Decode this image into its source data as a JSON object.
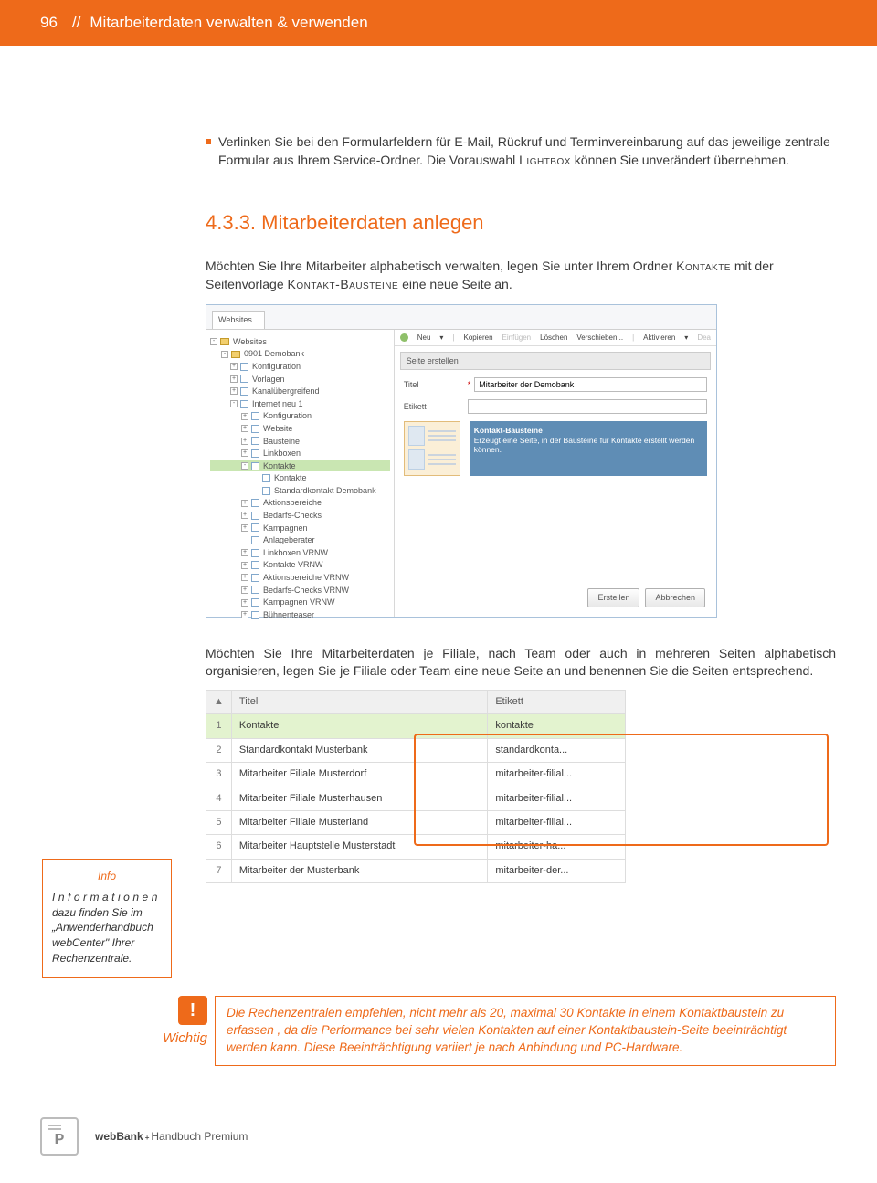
{
  "header": {
    "page_number": "96",
    "separator": "//",
    "title": "Mitarbeiterdaten verwalten & verwenden"
  },
  "bullet": {
    "text_a": "Verlinken Sie bei den Formularfeldern für E-Mail, Rückruf und Terminvereinbarung auf das jeweilige zentrale Formular aus Ihrem Service-Ordner. Die Vorauswahl ",
    "sc": "Lightbox",
    "text_b": " können Sie unverändert übernehmen."
  },
  "section": {
    "num": "4.3.3. ",
    "title": "Mitarbeiterdaten anlegen"
  },
  "intro": {
    "a": "Möchten Sie Ihre Mitarbeiter alphabetisch verwalten, legen Sie unter Ihrem Ordner ",
    "sc1": "Kontakte",
    "b": " mit der Seitenvorlage ",
    "sc2": "Kontakt-Bausteine",
    "c": " eine neue Seite an."
  },
  "ss": {
    "tab": "Websites",
    "toolbar": {
      "neu": "Neu",
      "kopieren": "Kopieren",
      "einfuegen": "Einfügen",
      "loeschen": "Löschen",
      "verschieben": "Verschieben...",
      "aktivieren": "Aktivieren",
      "dea": "Dea"
    },
    "create_hdr": "Seite erstellen",
    "form": {
      "titel_lbl": "Titel",
      "titel_val": "Mitarbeiter der Demobank",
      "etikett_lbl": "Etikett",
      "star": "*"
    },
    "desc": {
      "title": "Kontakt-Bausteine",
      "body": "Erzeugt eine Seite, in der Bausteine für Kontakte erstellt werden können."
    },
    "btn": {
      "erstellen": "Erstellen",
      "abbrechen": "Abbrechen"
    },
    "tree": [
      {
        "lvl": 0,
        "t": "fld",
        "txt": "Websites",
        "pm": "-"
      },
      {
        "lvl": 1,
        "t": "fld",
        "txt": "0901 Demobank",
        "pm": "-"
      },
      {
        "lvl": 2,
        "t": "pg",
        "txt": "Konfiguration",
        "pm": "+"
      },
      {
        "lvl": 2,
        "t": "pg",
        "txt": "Vorlagen",
        "pm": "+"
      },
      {
        "lvl": 2,
        "t": "pg",
        "txt": "Kanalübergreifend",
        "pm": "+"
      },
      {
        "lvl": 2,
        "t": "pg",
        "txt": "Internet neu 1",
        "pm": "-"
      },
      {
        "lvl": 3,
        "t": "pg",
        "txt": "Konfiguration",
        "pm": "+"
      },
      {
        "lvl": 3,
        "t": "pg",
        "txt": "Website",
        "pm": "+"
      },
      {
        "lvl": 3,
        "t": "pg",
        "txt": "Bausteine",
        "pm": "+"
      },
      {
        "lvl": 3,
        "t": "pg",
        "txt": "Linkboxen",
        "pm": "+"
      },
      {
        "lvl": 3,
        "t": "pg",
        "txt": "Kontakte",
        "pm": "-",
        "hl": true
      },
      {
        "lvl": 4,
        "t": "pg",
        "txt": "Kontakte",
        "pm": ""
      },
      {
        "lvl": 4,
        "t": "pg",
        "txt": "Standardkontakt Demobank",
        "pm": ""
      },
      {
        "lvl": 3,
        "t": "pg",
        "txt": "Aktionsbereiche",
        "pm": "+"
      },
      {
        "lvl": 3,
        "t": "pg",
        "txt": "Bedarfs-Checks",
        "pm": "+"
      },
      {
        "lvl": 3,
        "t": "pg",
        "txt": "Kampagnen",
        "pm": "+"
      },
      {
        "lvl": 3,
        "t": "pg",
        "txt": "Anlageberater",
        "pm": ""
      },
      {
        "lvl": 3,
        "t": "pg",
        "txt": "Linkboxen VRNW",
        "pm": "+"
      },
      {
        "lvl": 3,
        "t": "pg",
        "txt": "Kontakte VRNW",
        "pm": "+"
      },
      {
        "lvl": 3,
        "t": "pg",
        "txt": "Aktionsbereiche VRNW",
        "pm": "+"
      },
      {
        "lvl": 3,
        "t": "pg",
        "txt": "Bedarfs-Checks VRNW",
        "pm": "+"
      },
      {
        "lvl": 3,
        "t": "pg",
        "txt": "Kampagnen VRNW",
        "pm": "+"
      },
      {
        "lvl": 3,
        "t": "pg",
        "txt": "Bühnenteaser",
        "pm": "+"
      }
    ]
  },
  "mid_para": "Möchten Sie Ihre Mitarbeiterdaten je Filiale, nach Team oder auch in mehreren Seiten alphabetisch organisieren, legen Sie je Filiale oder Team eine neue Seite an und benennen Sie die Seiten entsprechend.",
  "table": {
    "hdr": {
      "titel": "Titel",
      "etikett": "Etikett"
    },
    "rows": [
      {
        "n": "1",
        "t": "Kontakte",
        "e": "kontakte",
        "hl": true
      },
      {
        "n": "2",
        "t": "Standardkontakt Musterbank",
        "e": "standardkonta..."
      },
      {
        "n": "3",
        "t": "Mitarbeiter Filiale Musterdorf",
        "e": "mitarbeiter-filial..."
      },
      {
        "n": "4",
        "t": "Mitarbeiter Filiale Musterhausen",
        "e": "mitarbeiter-filial..."
      },
      {
        "n": "5",
        "t": "Mitarbeiter Filiale Musterland",
        "e": "mitarbeiter-filial..."
      },
      {
        "n": "6",
        "t": "Mitarbeiter Hauptstelle Musterstadt",
        "e": "mitarbeiter-ha..."
      },
      {
        "n": "7",
        "t": "Mitarbeiter der Musterbank",
        "e": "mitarbeiter-der..."
      }
    ]
  },
  "info": {
    "title": "Info",
    "w1": "Informationen",
    "rest": " dazu finden Sie im „Anwenderhandbuch webCenter\" Ihrer Rechenzentrale."
  },
  "wichtig": {
    "label": "Wichtig",
    "icon": "!",
    "text": "Die Rechenzentralen empfehlen, nicht mehr als 20, maximal 30 Kontakte in einem Kontaktbaustein zu erfassen , da die Performance bei sehr vielen Kontakten auf einer Kontaktbaustein-Seite beeinträchtigt werden kann. Diese Beeinträchtigung variiert je nach Anbindung und PC-Hardware."
  },
  "footer": {
    "a": "webBank",
    "plus": "+",
    "b": " Handbuch Premium",
    "p": "P"
  }
}
